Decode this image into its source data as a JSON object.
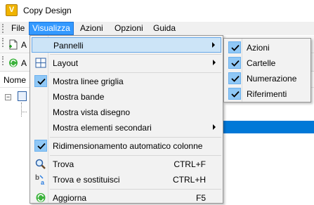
{
  "window": {
    "title": "Copy Design",
    "icon": "app-logo-icon",
    "icon_letter": "V"
  },
  "menubar": {
    "items": [
      {
        "label": "File"
      },
      {
        "label": "Visualizza"
      },
      {
        "label": "Azioni"
      },
      {
        "label": "Opzioni"
      },
      {
        "label": "Guida"
      }
    ]
  },
  "toolbar1": {
    "label": "A"
  },
  "toolbar2": {
    "label": "A"
  },
  "tree": {
    "header": "Nome",
    "collapse_symbol": "−"
  },
  "dropdown": {
    "items": [
      {
        "label": "Pannelli",
        "icon": "none",
        "submenu": true,
        "highlighted": true
      },
      {
        "label": "Layout",
        "icon": "grid-icon",
        "submenu": true
      },
      {
        "label": "Mostra linee griglia",
        "checked": true
      },
      {
        "label": "Mostra bande",
        "checked": false
      },
      {
        "label": "Mostra vista disegno",
        "checked": false
      },
      {
        "label": "Mostra elementi secondari",
        "checked": false,
        "submenu": true
      },
      {
        "label": "Ridimensionamento automatico colonne",
        "checked": true
      },
      {
        "label": "Trova",
        "icon": "magnifier-icon",
        "shortcut": "CTRL+F"
      },
      {
        "label": "Trova e sostituisci",
        "icon": "find-replace-icon",
        "shortcut": "CTRL+H"
      },
      {
        "label": "Aggiorna",
        "icon": "refresh-icon",
        "shortcut": "F5"
      }
    ]
  },
  "submenu": {
    "items": [
      {
        "label": "Azioni",
        "checked": true
      },
      {
        "label": "Cartelle",
        "checked": true
      },
      {
        "label": "Numerazione",
        "checked": true
      },
      {
        "label": "Riferimenti",
        "checked": true
      }
    ]
  },
  "colors": {
    "accent": "#3399ff",
    "highlight": "#cce4f7",
    "check_bg": "#90c8f6",
    "selection": "#0078d7"
  }
}
